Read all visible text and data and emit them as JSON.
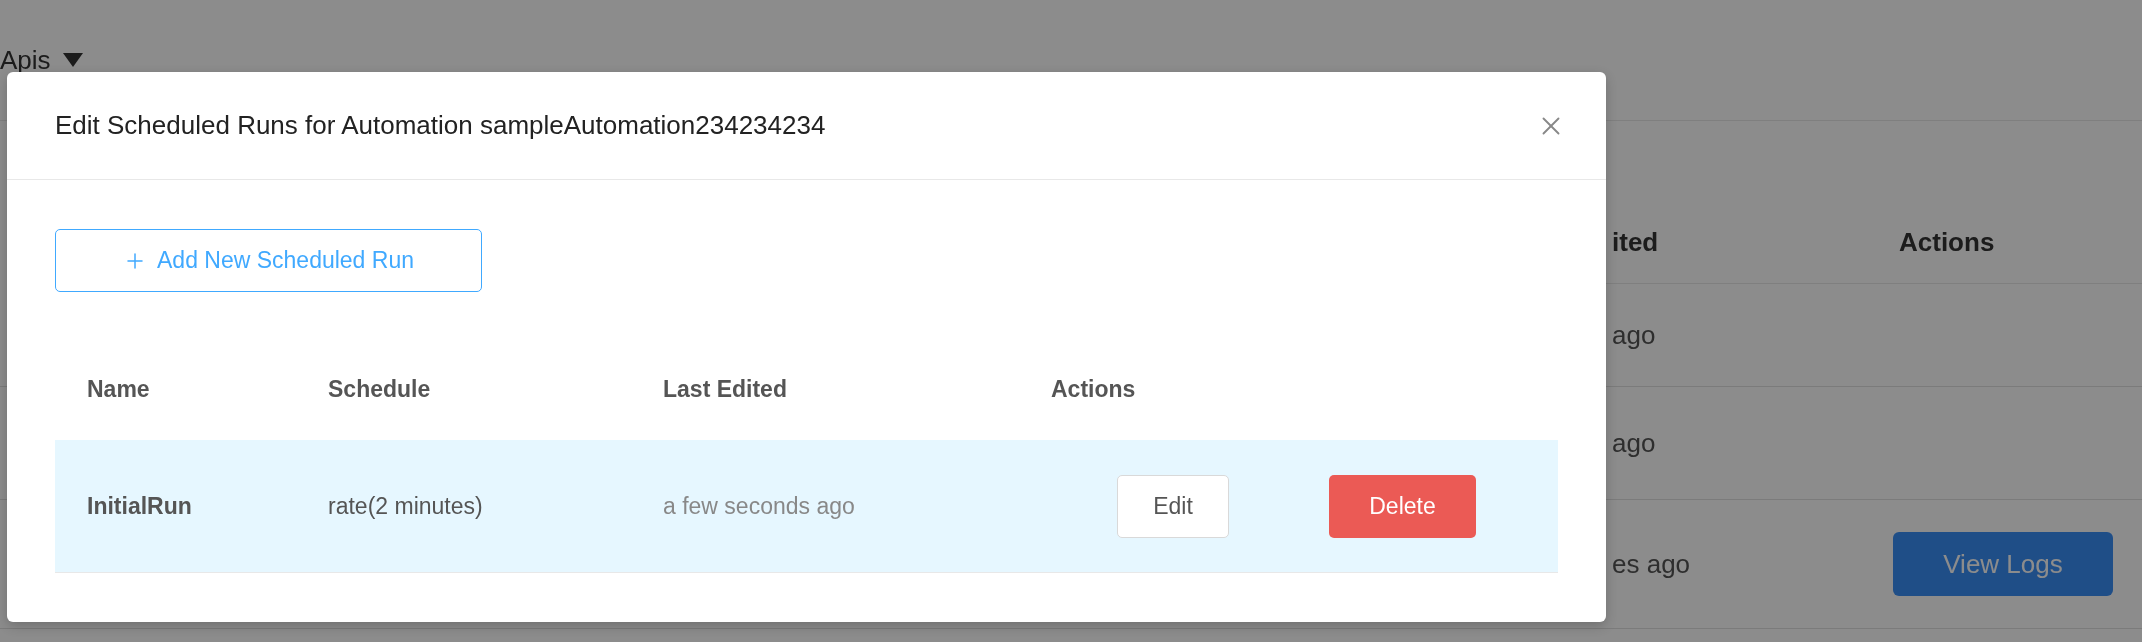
{
  "background": {
    "nav": {
      "label": "Apis"
    },
    "table": {
      "columns": [
        "ited",
        "Actions"
      ],
      "rows": [
        {
          "last_edited": "ago"
        },
        {
          "last_edited": "ago"
        },
        {
          "last_edited": "es ago",
          "action": "View Logs"
        }
      ]
    }
  },
  "modal": {
    "title": "Edit Scheduled Runs for Automation sampleAutomation234234234",
    "add_button": {
      "label": "Add New Scheduled Run"
    },
    "table": {
      "columns": [
        "Name",
        "Schedule",
        "Last Edited",
        "Actions"
      ],
      "rows": [
        {
          "name": "InitialRun",
          "schedule": "rate(2 minutes)",
          "last_edited": "a few seconds ago",
          "highlighted": true,
          "actions": [
            {
              "label": "Edit",
              "kind": "default"
            },
            {
              "label": "Delete",
              "kind": "danger"
            }
          ]
        }
      ]
    }
  }
}
